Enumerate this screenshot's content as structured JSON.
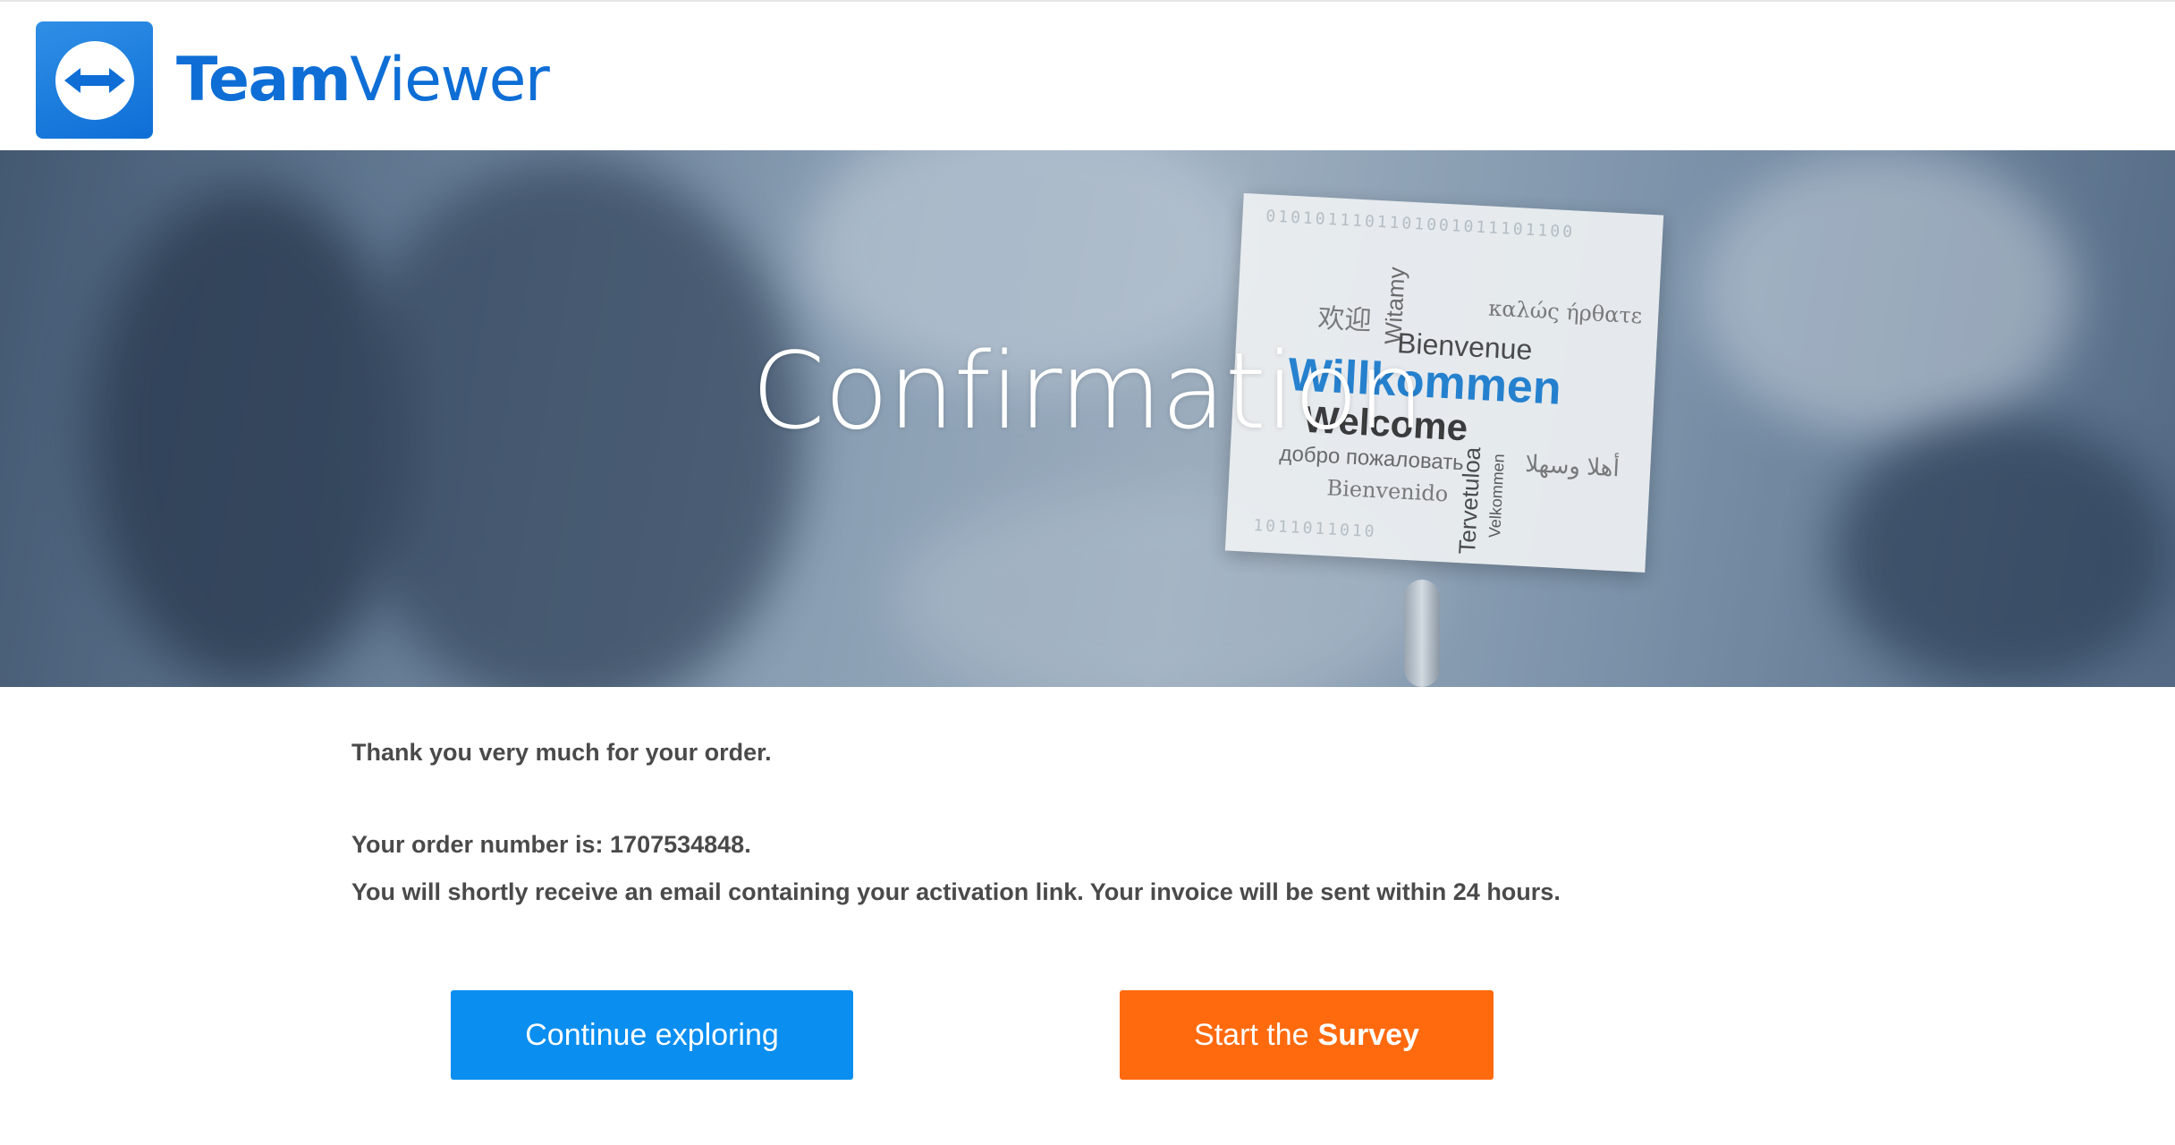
{
  "brand": {
    "name_bold": "Team",
    "name_light": "Viewer",
    "primary_color": "#0e6ed6"
  },
  "hero": {
    "title": "Confirmation",
    "card_words": {
      "binary_top": "0101011101101001011101100",
      "chinese": "欢迎",
      "witamy": "Witamy",
      "greek": "καλώς ήρθατε",
      "bienvenue": "Bienvenue",
      "willkommen": "Willkommen",
      "welcome": "Welcome",
      "russian": "добро пожаловать",
      "arabic": "أهلا وسهلا",
      "bienvenido": "Bienvenido",
      "tervetuloa": "Tervetuloa",
      "velkommen": "Velkommen",
      "binary_bottom": "1011011010"
    }
  },
  "content": {
    "thanks": "Thank you very much for your order.",
    "order_number_line": "Your order number is: 1707534848.",
    "activation_line": "You will shortly receive an email containing your activation link. Your invoice will be sent within 24 hours."
  },
  "buttons": {
    "continue": {
      "label": "Continue exploring",
      "color": "#0a8ef0"
    },
    "survey": {
      "label_prefix": "Start the",
      "label_bold": "Survey",
      "color": "#ff6a0f"
    }
  }
}
